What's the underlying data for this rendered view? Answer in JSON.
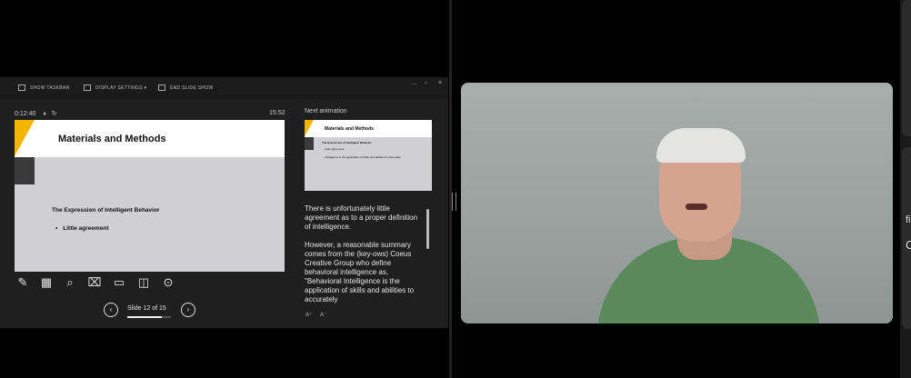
{
  "toolbar": {
    "show_taskbar": "SHOW TASKBAR",
    "display_settings": "DISPLAY SETTINGS ▾",
    "end_slide_show": "END SLIDE SHOW",
    "more": "…",
    "restore": "▫",
    "close": "×"
  },
  "presenter": {
    "timer": "0:12:40",
    "pause": "⏸",
    "reset": "↻",
    "clock": "15:52",
    "next_label": "Next animation",
    "slide_counter": "Slide 12 of 15",
    "prev": "‹",
    "next": "›",
    "font_up": "A⁺",
    "font_down": "A⁻",
    "progress_fraction": 0.8
  },
  "current_slide": {
    "title": "Materials and Methods",
    "subtitle": "The Expression of Intelligent Behavior",
    "bullet": "Little agreement"
  },
  "next_slide": {
    "title": "Materials and Methods",
    "subtitle": "The Expression of Intelligent Behavior",
    "bullet1": "Little agreement",
    "bullet2": "Intelligence is the application of skills and abilities to accurately"
  },
  "notes": {
    "p1": "There is unfortunately little agreement as to a proper definition of intelligence.",
    "p2": "However, a reasonable summary comes from the (key-ows) Coeus Creative Group who define behavioral intelligence as, \"Behavioral Intelligence is the application of skills and abilities to accurately"
  },
  "edge": {
    "t1": "fi",
    "t2": "C"
  },
  "icons": [
    "pen-icon",
    "slides-grid-icon",
    "zoom-icon",
    "pointer-icon",
    "subtitles-icon",
    "black-screen-icon",
    "more-options-icon"
  ]
}
